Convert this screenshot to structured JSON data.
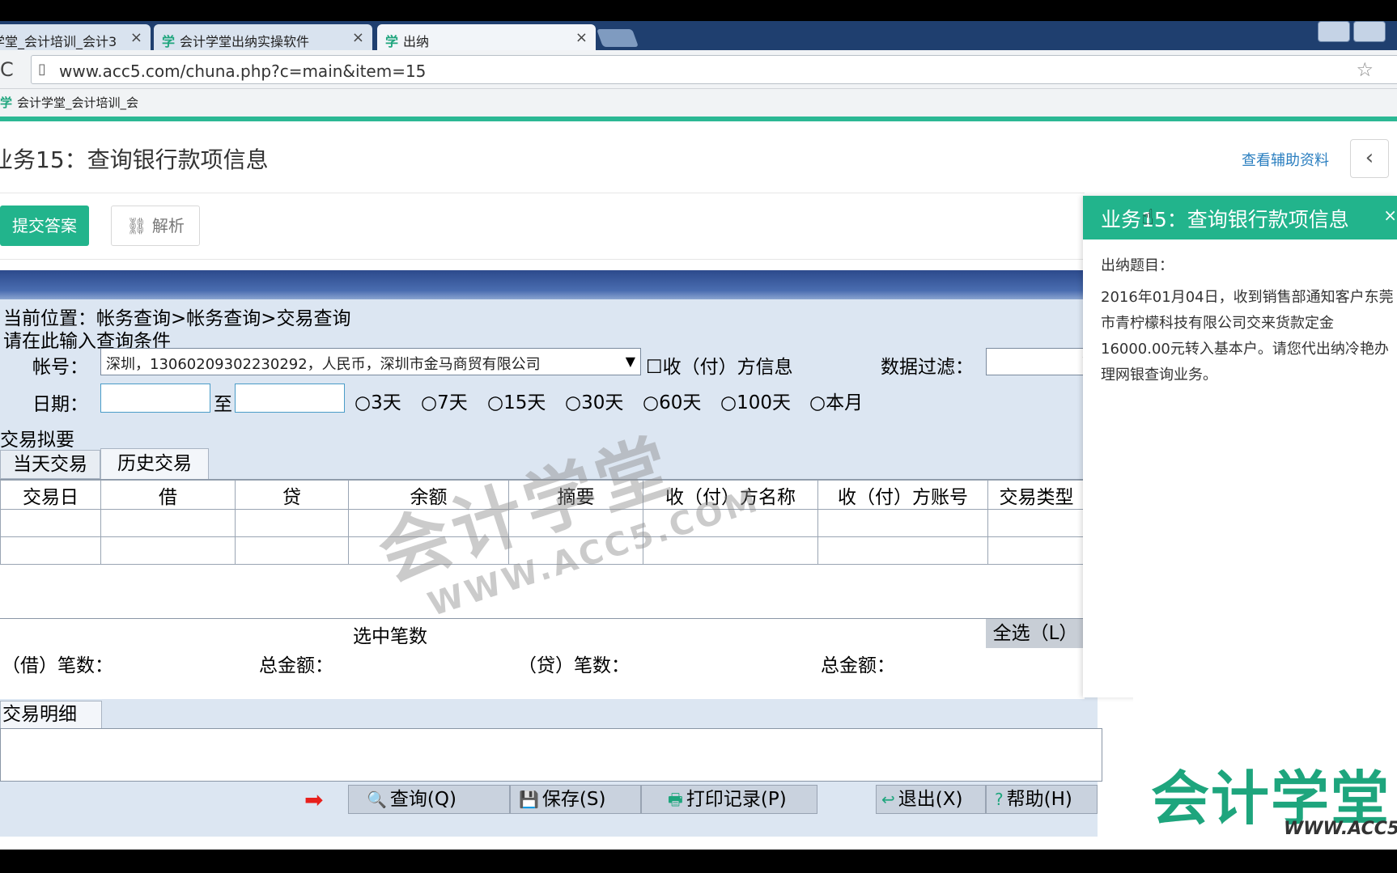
{
  "browser": {
    "tabs": [
      {
        "label": "学堂_会计培训_会计3"
      },
      {
        "label": "会计学堂出纳实操软件"
      },
      {
        "label": "出纳"
      }
    ],
    "tab_logo": "学",
    "close_glyph": "×",
    "url": "www.acc5.com/chuna.php?c=main&item=15",
    "bookmark": "会计学堂_会计培训_会"
  },
  "page": {
    "title": "业务15：查询银行款项信息",
    "aux_link": "查看辅助资料",
    "prev_glyph": "‹",
    "submit_label": "提交答案",
    "analysis_label": "解析"
  },
  "app": {
    "breadcrumb": "当前位置：帐务查询>帐务查询>交易查询",
    "condition_label": "请在此输入查询条件",
    "account_label": "帐号：",
    "account_value": "深圳，13060209302230292，人民币，深圳市金马商贸有限公司",
    "counterparty_check": "☐收（付）方信息",
    "filter_label": "数据过滤：",
    "date_label": "日期：",
    "date_to": "至",
    "date_ranges": [
      "○3天",
      "○7天",
      "○15天",
      "○30天",
      "○60天",
      "○100天",
      "○本月"
    ],
    "summary_section": "交易拟要",
    "tab_today": "当天交易",
    "tab_history": "历史交易",
    "columns": [
      "交易日",
      "借",
      "贷",
      "余额",
      "摘要",
      "收（付）方名称",
      "收（付）方账号",
      "交易类型"
    ],
    "selected_count": "选中笔数",
    "select_all": "全选（L）",
    "debit_count": "（借）笔数：",
    "debit_total": "总金额：",
    "credit_count": "（贷）笔数：",
    "credit_total": "总金额：",
    "detail_tab": "交易明细",
    "buttons": {
      "query": "查询(Q)",
      "save": "保存(S)",
      "print": "打印记录(P)",
      "exit": "退出(X)",
      "help": "帮助(H)"
    }
  },
  "panel": {
    "title": "业务15：查询银行款项信息",
    "subtitle": "出纳题目：",
    "body": "2016年01月04日，收到销售部通知客户东莞市青柠檬科技有限公司交来货款定金16000.00元转入基本户。请您代出纳冷艳办理网银查询业务。"
  },
  "branding": {
    "logo_text": "会计学堂",
    "logo_url": "WWW.ACC5",
    "watermark": "会计学堂",
    "watermark_url": "WWW.ACC5.COM"
  },
  "colors": {
    "accent_green": "#22b48c",
    "link_blue": "#2b7fc0",
    "app_bg": "#dce6f2"
  }
}
